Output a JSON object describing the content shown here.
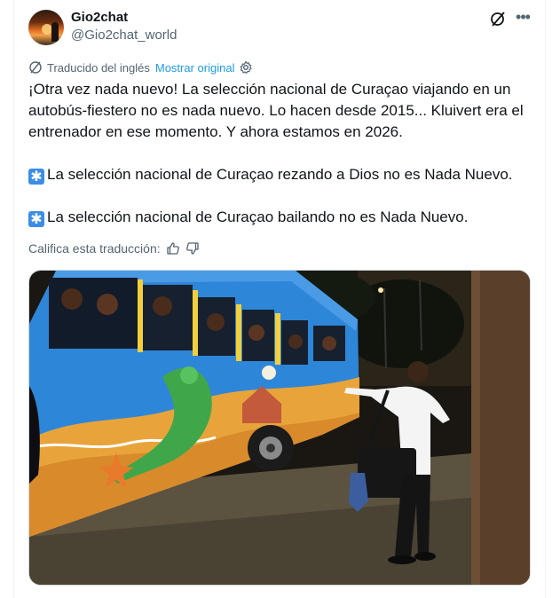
{
  "author": {
    "display_name": "Gio2chat",
    "handle": "@Gio2chat_world"
  },
  "header": {
    "icons": [
      "grok-icon",
      "more-icon"
    ]
  },
  "translation": {
    "label": "Traducido del inglés",
    "show_original": "Mostrar original"
  },
  "tweet": {
    "paragraph1": "¡Otra vez nada nuevo! La selección nacional de Curaçao viajando en un autobús-fiestero no es nada nuevo. Lo hacen desde 2015... Kluivert era el entrenador en ese momento. Y ahora estamos en 2026.",
    "asterisk_symbol": "✱",
    "paragraph2": "La selección nacional de Curaçao rezando a Dios no es Nada Nuevo.",
    "paragraph3": "La selección nacional de Curaçao bailando no es Nada Nuevo."
  },
  "rate": {
    "label": "Califica esta traducción:"
  },
  "colors": {
    "link": "#1d9bf0",
    "secondary_text": "#536471",
    "bus_blue": "#2e86d8"
  }
}
